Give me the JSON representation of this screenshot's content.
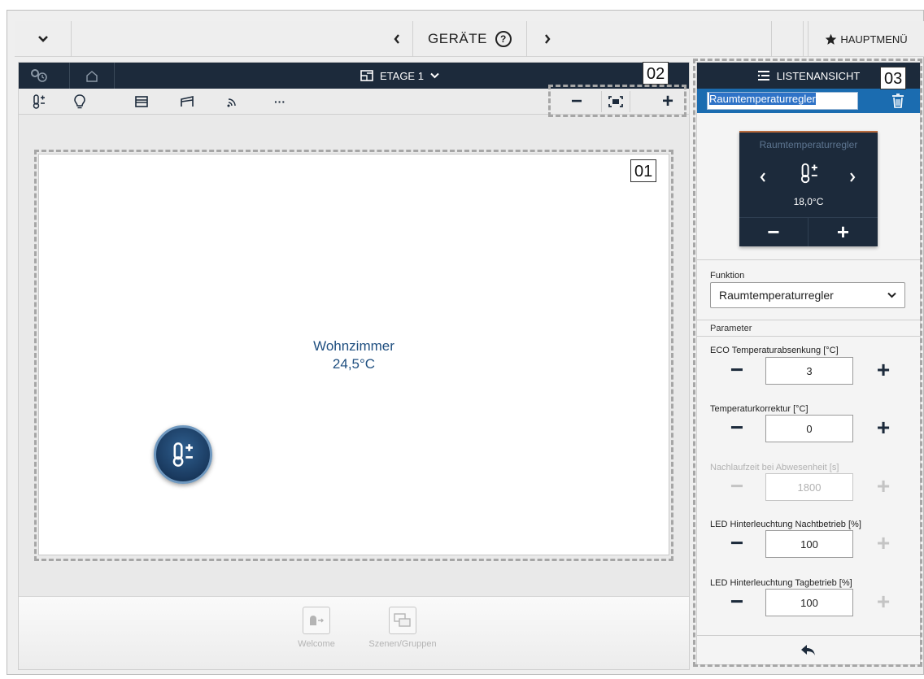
{
  "topbar": {
    "title": "GERÄTE",
    "help_glyph": "?",
    "main_menu_label": "HAUPTMENÜ",
    "icons": [
      "chevron-down-icon",
      "prev-icon",
      "next-icon",
      "star-icon"
    ]
  },
  "floorplan": {
    "floor_label": "ETAGE 1",
    "room": {
      "name": "Wohnzimmer",
      "temperature": "24,5°C"
    },
    "toolbar_icons": [
      "thermostat-icon",
      "lightbulb-icon",
      "blind-icon",
      "awning-icon",
      "wireless-icon",
      "more-icon"
    ],
    "more_glyph": "···",
    "zoom": {
      "out": "−",
      "fit": "fit-icon",
      "in": "+"
    },
    "bottom_items": [
      {
        "label": "Welcome",
        "icon": "doorbell-icon"
      },
      {
        "label": "Szenen/Gruppen",
        "icon": "scenes-icon"
      }
    ]
  },
  "callouts": [
    "01",
    "02",
    "03"
  ],
  "panel": {
    "header": "LISTENANSICHT",
    "device_name": "Raumtemperaturregler",
    "tile": {
      "title": "Raumtemperaturregler",
      "temperature": "18,0°C",
      "minus": "−",
      "plus": "+"
    },
    "function_label": "Funktion",
    "function_value": "Raumtemperaturregler",
    "parameter_label": "Parameter",
    "parameters": [
      {
        "label": "ECO Temperaturabsenkung [°C]",
        "value": "3",
        "enabled": true,
        "plus_enabled": true
      },
      {
        "label": "Temperaturkorrektur [°C]",
        "value": "0",
        "enabled": true,
        "plus_enabled": true
      },
      {
        "label": "Nachlaufzeit bei Abwesenheit [s]",
        "value": "1800",
        "enabled": false,
        "plus_enabled": false
      },
      {
        "label": "LED Hinterleuchtung Nachtbetrieb [%]",
        "value": "100",
        "enabled": true,
        "plus_enabled": false
      },
      {
        "label": "LED Hinterleuchtung Tagbetrieb [%]",
        "value": "100",
        "enabled": true,
        "plus_enabled": false
      }
    ],
    "back_icon": "back-arrow-icon"
  },
  "colors": {
    "dark_bar": "#1c2a3b",
    "accent_blue": "#1b6cb0",
    "room_text": "#1f4f80"
  }
}
